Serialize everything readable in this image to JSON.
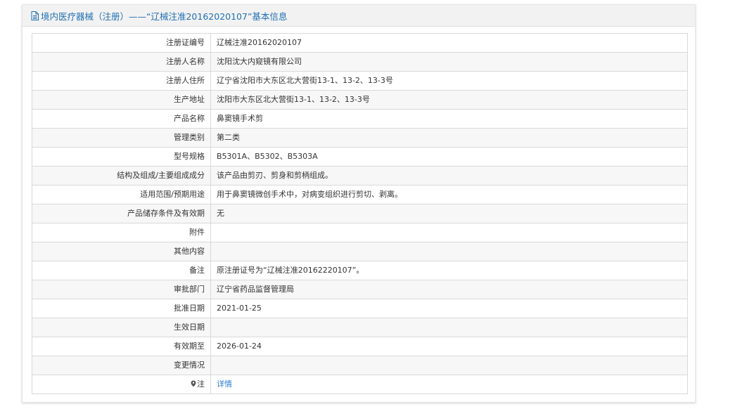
{
  "header": {
    "title": "境内医疗器械（注册）——“辽械注准20162020107”基本信息",
    "icon": "document-icon"
  },
  "rows": [
    {
      "label": "注册证编号",
      "value": "辽械注准20162020107"
    },
    {
      "label": "注册人名称",
      "value": "沈阳沈大内窥镜有限公司"
    },
    {
      "label": "注册人住所",
      "value": "辽宁省沈阳市大东区北大营街13-1、13-2、13-3号"
    },
    {
      "label": "生产地址",
      "value": "沈阳市大东区北大营街13-1、13-2、13-3号"
    },
    {
      "label": "产品名称",
      "value": "鼻窦镜手术剪"
    },
    {
      "label": "管理类别",
      "value": "第二类"
    },
    {
      "label": "型号规格",
      "value": "B5301A、B5302、B5303A"
    },
    {
      "label": "结构及组成/主要组成成分",
      "value": "该产品由剪刃、剪身和剪柄组成。"
    },
    {
      "label": "适用范围/预期用途",
      "value": "用于鼻窦镜微创手术中，对病变组织进行剪切、剥离。"
    },
    {
      "label": "产品储存条件及有效期",
      "value": "无"
    },
    {
      "label": "附件",
      "value": ""
    },
    {
      "label": "其他内容",
      "value": ""
    },
    {
      "label": "备注",
      "value": "原注册证号为“辽械注准20162220107”。"
    },
    {
      "label": "审批部门",
      "value": "辽宁省药品监督管理局"
    },
    {
      "label": "批准日期",
      "value": "2021-01-25"
    },
    {
      "label": "生效日期",
      "value": ""
    },
    {
      "label": "有效期至",
      "value": "2026-01-24"
    },
    {
      "label": "变更情况",
      "value": ""
    }
  ],
  "note_row": {
    "label": "注",
    "icon": "map-pin-icon",
    "link_text": "详情"
  },
  "colors": {
    "header_text": "#1f6fb2",
    "link": "#2b7bd1",
    "border": "#d9d9d9",
    "row_alt": "#f7f7f7"
  }
}
